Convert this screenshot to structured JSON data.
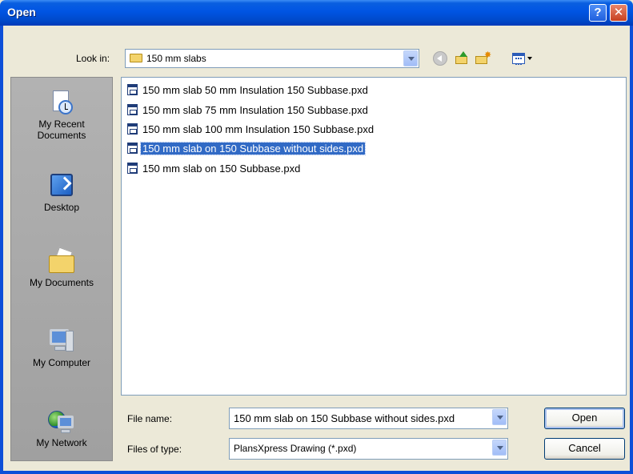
{
  "window": {
    "title": "Open"
  },
  "title_buttons": {
    "help": "?",
    "close": "✕"
  },
  "lookin": {
    "label": "Look in:",
    "value": "150 mm slabs"
  },
  "toolbar": {
    "icons": [
      "back-icon",
      "up-folder-icon",
      "new-folder-icon",
      "view-menu-icon"
    ]
  },
  "places": [
    {
      "label_line1": "My Recent",
      "label_line2": "Documents",
      "icon": "recent-documents-icon"
    },
    {
      "label_line1": "Desktop",
      "label_line2": "",
      "icon": "desktop-icon"
    },
    {
      "label_line1": "My Documents",
      "label_line2": "",
      "icon": "my-documents-icon"
    },
    {
      "label_line1": "My Computer",
      "label_line2": "",
      "icon": "my-computer-icon"
    },
    {
      "label_line1": "My Network",
      "label_line2": "",
      "icon": "my-network-icon"
    }
  ],
  "files": [
    {
      "name": "150 mm slab 50 mm Insulation 150 Subbase.pxd",
      "selected": false
    },
    {
      "name": "150 mm slab 75 mm Insulation 150 Subbase.pxd",
      "selected": false
    },
    {
      "name": "150 mm slab 100 mm Insulation 150 Subbase.pxd",
      "selected": false
    },
    {
      "name": "150 mm slab on 150 Subbase without sides.pxd",
      "selected": true
    },
    {
      "name": "150 mm slab on 150 Subbase.pxd",
      "selected": false
    }
  ],
  "file_name": {
    "label": "File name:",
    "value": "150 mm slab on 150 Subbase without sides.pxd"
  },
  "file_type": {
    "label": "Files of type:",
    "value": "PlansXpress Drawing (*.pxd)"
  },
  "buttons": {
    "open": "Open",
    "cancel": "Cancel"
  },
  "colors": {
    "titlebar": "#0054e3",
    "selection": "#316ac5",
    "dialog_bg": "#ece9d8"
  }
}
